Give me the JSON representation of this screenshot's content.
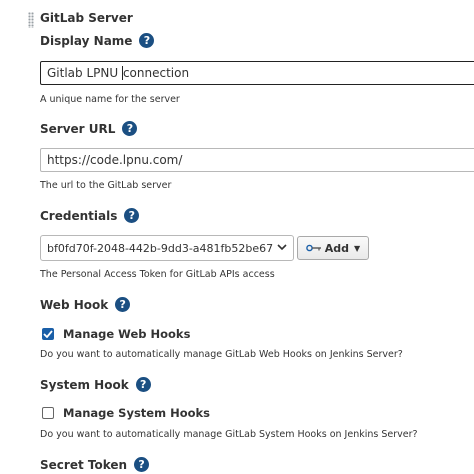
{
  "section_title": "GitLab Server",
  "display_name": {
    "label": "Display Name",
    "value_before_cursor": "Gitlab LPNU ",
    "value_after_cursor": "connection",
    "description": "A unique name for the server"
  },
  "server_url": {
    "label": "Server URL",
    "value": "https://code.lpnu.com/",
    "description": "The url to the GitLab server"
  },
  "credentials": {
    "label": "Credentials",
    "selected": "bf0fd70f-2048-442b-9dd3-a481fb52be67",
    "add_label": "Add",
    "description": "The Personal Access Token for GitLab APIs access"
  },
  "web_hook": {
    "label": "Web Hook",
    "checkbox_label": "Manage Web Hooks",
    "checked": true,
    "description": "Do you want to automatically manage GitLab Web Hooks on Jenkins Server?"
  },
  "system_hook": {
    "label": "System Hook",
    "checkbox_label": "Manage System Hooks",
    "checked": false,
    "description": "Do you want to automatically manage GitLab System Hooks on Jenkins Server?"
  },
  "secret_token": {
    "label": "Secret Token"
  },
  "help_glyph": "?",
  "colors": {
    "help_icon": "#1b4f82",
    "checkbox_checked": "#1a5fa8",
    "text": "#333333"
  }
}
